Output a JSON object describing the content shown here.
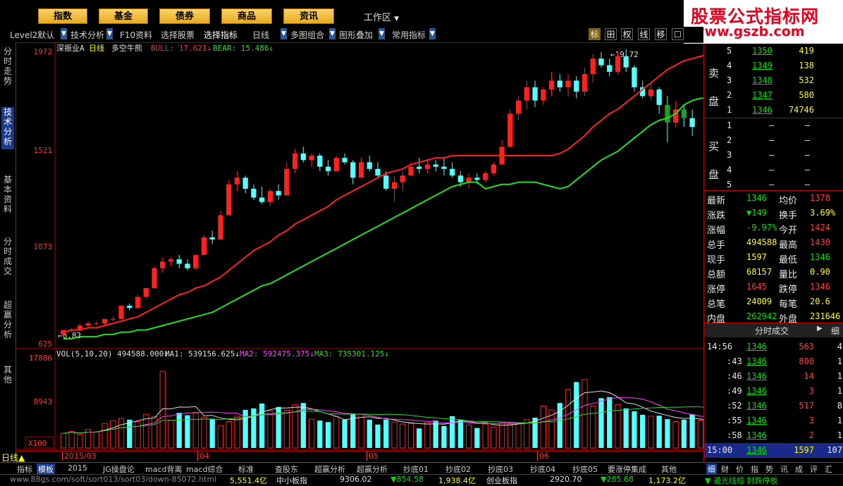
{
  "topnav": {
    "buttons": [
      "指数",
      "基金",
      "债券",
      "商品",
      "资讯"
    ],
    "workarea": "工作区"
  },
  "watermark": {
    "line1": "股票公式指标网",
    "line2": "www.gszb.com"
  },
  "toolbar": {
    "items": [
      "Level2默认",
      "技术分析",
      "F10资料",
      "选择股票",
      "选择指标",
      "日线",
      "多图组合",
      "图形叠加",
      "常用指标"
    ],
    "icons": [
      "标",
      "田",
      "权",
      "线",
      "移",
      "☐"
    ]
  },
  "lefttabs": [
    "分时走势",
    "技术分析",
    "基本资料",
    "分时成交",
    "超赢分析",
    "其他"
  ],
  "chart": {
    "stock_label": "深振业A",
    "period_label": "日线",
    "indicator_name": "多空牛熊",
    "bull_text": "BULL: 17.621↓",
    "bear_text": "BEAR: 15.486↓",
    "price_ticks": [
      "1972",
      "1521",
      "1073",
      "625"
    ],
    "high_note": "←19.72",
    "low_note": "←6.82",
    "vol_text": "VOL(5,10,20) 494588.000↓",
    "ma1_text": "MA1: 539156.625↓",
    "ma2_text": "MA2: 592475.375↓",
    "ma3_text": "MA3: 735301.125↓",
    "vol_ticks": [
      "17886",
      "8943"
    ],
    "vol_unit": "X100",
    "months": [
      "2015/03",
      "04",
      "05",
      "06"
    ],
    "colors": {
      "up": "#ff2020",
      "down": "#55ffff",
      "bull": "#ff2020",
      "bear": "#20e020"
    }
  },
  "chart_data": {
    "type": "candlestick",
    "candles": [
      [
        6.8,
        7.0,
        6.7,
        7.0
      ],
      [
        7.0,
        7.1,
        6.9,
        7.0
      ],
      [
        7.0,
        7.3,
        7.0,
        7.2
      ],
      [
        7.2,
        7.4,
        7.1,
        7.3
      ],
      [
        7.3,
        7.4,
        7.2,
        7.3
      ],
      [
        7.3,
        7.5,
        7.2,
        7.5
      ],
      [
        7.5,
        7.6,
        7.4,
        7.5
      ],
      [
        7.5,
        8.1,
        7.5,
        8.1
      ],
      [
        8.1,
        8.2,
        7.9,
        8.0
      ],
      [
        8.0,
        8.6,
        8.0,
        8.5
      ],
      [
        8.5,
        8.9,
        8.4,
        8.9
      ],
      [
        8.9,
        9.9,
        8.9,
        9.8
      ],
      [
        9.8,
        10.3,
        9.6,
        10.1
      ],
      [
        10.1,
        10.3,
        9.9,
        10.2
      ],
      [
        10.2,
        10.4,
        9.8,
        10.0
      ],
      [
        10.0,
        10.2,
        9.7,
        9.8
      ],
      [
        9.8,
        10.4,
        9.7,
        10.4
      ],
      [
        10.4,
        11.3,
        10.4,
        11.2
      ],
      [
        11.2,
        11.5,
        10.9,
        11.1
      ],
      [
        11.1,
        12.4,
        11.1,
        12.2
      ],
      [
        12.2,
        13.8,
        12.2,
        13.6
      ],
      [
        13.6,
        14.2,
        13.3,
        13.9
      ],
      [
        13.9,
        14.0,
        13.2,
        13.4
      ],
      [
        13.4,
        13.6,
        12.9,
        13.0
      ],
      [
        13.0,
        13.5,
        12.7,
        12.8
      ],
      [
        12.8,
        13.4,
        12.6,
        13.3
      ],
      [
        13.3,
        13.6,
        12.9,
        13.1
      ],
      [
        13.1,
        14.6,
        13.1,
        14.3
      ],
      [
        14.3,
        15.2,
        14.1,
        15.0
      ],
      [
        15.0,
        15.3,
        14.6,
        14.7
      ],
      [
        14.7,
        15.0,
        14.4,
        14.9
      ],
      [
        14.9,
        15.0,
        14.2,
        14.4
      ],
      [
        14.4,
        14.7,
        14.0,
        14.2
      ],
      [
        14.2,
        14.9,
        14.2,
        14.8
      ],
      [
        14.8,
        15.0,
        14.5,
        14.6
      ],
      [
        14.6,
        14.7,
        13.6,
        13.9
      ],
      [
        13.9,
        14.8,
        13.9,
        14.6
      ],
      [
        14.6,
        14.9,
        14.2,
        14.3
      ],
      [
        14.3,
        14.6,
        13.9,
        14.0
      ],
      [
        14.0,
        14.2,
        13.3,
        13.4
      ],
      [
        13.4,
        14.0,
        12.8,
        13.7
      ],
      [
        13.7,
        14.2,
        13.3,
        14.0
      ],
      [
        14.0,
        14.6,
        14.0,
        14.4
      ],
      [
        14.4,
        14.8,
        14.1,
        14.3
      ],
      [
        14.3,
        14.7,
        14.1,
        14.5
      ],
      [
        14.5,
        14.7,
        14.2,
        14.4
      ],
      [
        14.4,
        14.8,
        14.0,
        14.3
      ],
      [
        14.3,
        14.6,
        13.9,
        14.0
      ],
      [
        14.0,
        14.2,
        13.5,
        13.7
      ],
      [
        13.7,
        14.1,
        13.4,
        13.9
      ],
      [
        13.9,
        14.1,
        13.6,
        13.8
      ],
      [
        13.8,
        14.2,
        13.7,
        14.1
      ],
      [
        14.1,
        14.6,
        14.0,
        14.5
      ],
      [
        14.5,
        15.6,
        14.5,
        15.3
      ],
      [
        15.3,
        17.0,
        15.3,
        16.8
      ],
      [
        16.8,
        17.6,
        16.5,
        17.4
      ],
      [
        17.4,
        18.3,
        17.0,
        18.0
      ],
      [
        18.0,
        18.3,
        17.1,
        17.4
      ],
      [
        17.4,
        18.0,
        17.2,
        17.9
      ],
      [
        17.9,
        18.7,
        17.6,
        18.3
      ],
      [
        18.3,
        18.6,
        17.8,
        18.0
      ],
      [
        18.0,
        18.6,
        17.6,
        18.3
      ],
      [
        18.3,
        18.5,
        17.5,
        17.8
      ],
      [
        17.8,
        18.9,
        17.6,
        18.6
      ],
      [
        18.6,
        19.5,
        18.2,
        19.3
      ],
      [
        19.3,
        19.6,
        18.9,
        19.0
      ],
      [
        19.0,
        19.3,
        18.5,
        18.7
      ],
      [
        18.7,
        19.6,
        18.6,
        19.4
      ],
      [
        19.4,
        19.72,
        18.7,
        18.9
      ],
      [
        18.9,
        19.0,
        17.8,
        18.0
      ],
      [
        18.0,
        18.3,
        17.5,
        17.6
      ],
      [
        17.6,
        18.2,
        17.4,
        17.9
      ],
      [
        17.9,
        18.0,
        16.8,
        17.2
      ],
      [
        17.2,
        17.6,
        15.5,
        16.4
      ],
      [
        16.4,
        17.4,
        16.2,
        17.0
      ],
      [
        17.0,
        17.2,
        16.2,
        16.6
      ],
      [
        16.6,
        17.0,
        15.8,
        16.2
      ]
    ],
    "bull": [
      6.9,
      7.0,
      7.0,
      7.1,
      7.1,
      7.2,
      7.3,
      7.4,
      7.5,
      7.6,
      7.8,
      8.0,
      8.2,
      8.4,
      8.6,
      8.7,
      8.9,
      9.0,
      9.2,
      9.4,
      9.7,
      10.0,
      10.3,
      10.6,
      10.8,
      11.0,
      11.3,
      11.5,
      11.8,
      12.0,
      12.2,
      12.4,
      12.6,
      12.9,
      13.1,
      13.3,
      13.5,
      13.7,
      13.9,
      14.1,
      14.2,
      14.3,
      14.5,
      14.6,
      14.7,
      14.8,
      14.8,
      14.9,
      14.9,
      14.9,
      14.9,
      14.9,
      14.9,
      14.9,
      14.9,
      14.9,
      14.9,
      14.9,
      14.9,
      14.9,
      15.0,
      15.2,
      15.5,
      15.8,
      16.2,
      16.5,
      16.8,
      17.0,
      17.3,
      17.6,
      17.9,
      18.2,
      18.5,
      18.8,
      19.0,
      19.2,
      19.3,
      19.4,
      19.5,
      19.5,
      19.4,
      19.3
    ],
    "bear": [
      6.6,
      6.6,
      6.7,
      6.7,
      6.7,
      6.8,
      6.8,
      6.9,
      6.9,
      7.0,
      7.0,
      7.1,
      7.2,
      7.3,
      7.4,
      7.5,
      7.6,
      7.7,
      7.8,
      8.0,
      8.2,
      8.4,
      8.6,
      8.8,
      9.0,
      9.1,
      9.3,
      9.5,
      9.7,
      9.9,
      10.1,
      10.3,
      10.5,
      10.7,
      10.9,
      11.1,
      11.3,
      11.5,
      11.7,
      11.9,
      12.1,
      12.3,
      12.5,
      12.7,
      12.9,
      13.1,
      13.3,
      13.5,
      13.6,
      13.7,
      13.7,
      13.4,
      13.5,
      13.6,
      13.6,
      13.7,
      13.7,
      13.7,
      13.6,
      13.5,
      13.4,
      13.5,
      13.8,
      14.1,
      14.4,
      14.7,
      14.9,
      15.1,
      15.4,
      15.7,
      16.0,
      16.3,
      16.5,
      16.6,
      16.8,
      17.2,
      17.4,
      17.5,
      17.5,
      17.4,
      17.4,
      17.2,
      17.1,
      17.0
    ],
    "volume": [
      3000,
      3400,
      2800,
      3800,
      3300,
      5000,
      5600,
      6100,
      5800,
      5400,
      6900,
      6400,
      15700,
      5700,
      7200,
      6700,
      7100,
      6300,
      6000,
      4600,
      5400,
      6500,
      7800,
      8100,
      9100,
      7600,
      8400,
      7700,
      8900,
      9200,
      5900,
      5600,
      5300,
      6400,
      5800,
      7000,
      6900,
      5800,
      4800,
      5800,
      5300,
      4900,
      5000,
      4000,
      5200,
      5600,
      4500,
      6500,
      5800,
      4700,
      4100,
      4900,
      4300,
      5300,
      4900,
      5100,
      5800,
      6200,
      8600,
      7800,
      9200,
      12000,
      13500,
      14000,
      8600,
      10200,
      10400,
      8900,
      8100,
      7500,
      6800,
      6500,
      6600,
      5900,
      5400,
      5800,
      6900,
      5700,
      4600,
      5200,
      5400,
      4900,
      4500
    ],
    "ylim": [
      6.25,
      19.72
    ],
    "x_ticks": [
      "2015/03",
      "04",
      "05",
      "06"
    ]
  },
  "orderbook": {
    "sell_label": "卖盘",
    "buy_label": "买盘",
    "sell": [
      {
        "lvl": "5",
        "price": "1350",
        "vol": "419"
      },
      {
        "lvl": "4",
        "price": "1349",
        "vol": "138"
      },
      {
        "lvl": "3",
        "price": "1348",
        "vol": "532"
      },
      {
        "lvl": "2",
        "price": "1347",
        "vol": "580"
      },
      {
        "lvl": "1",
        "price": "1346",
        "vol": "74746"
      }
    ],
    "buy": [
      {
        "lvl": "1",
        "price": "—",
        "vol": "—"
      },
      {
        "lvl": "2",
        "price": "—",
        "vol": "—"
      },
      {
        "lvl": "3",
        "price": "—",
        "vol": "—"
      },
      {
        "lvl": "4",
        "price": "—",
        "vol": "—"
      },
      {
        "lvl": "5",
        "price": "—",
        "vol": "—"
      }
    ]
  },
  "quote": [
    {
      "l1": "最新",
      "v1": "1346",
      "l2": "均价",
      "v2": "1378"
    },
    {
      "l1": "涨跌",
      "v1": "▼149",
      "l2": "换手",
      "v2": "3.69%"
    },
    {
      "l1": "涨幅",
      "v1": "-9.97%",
      "l2": "今开",
      "v2": "1424"
    },
    {
      "l1": "总手",
      "v1": "494588",
      "l2": "最高",
      "v2": "1430"
    },
    {
      "l1": "现手",
      "v1": "1597",
      "l2": "最低",
      "v2": "1346"
    },
    {
      "l1": "总额",
      "v1": "68157",
      "l2": "量比",
      "v2": "0.90"
    },
    {
      "l1": "涨停",
      "v1": "1645",
      "l2": "跌停",
      "v2": "1346"
    },
    {
      "l1": "总笔",
      "v1": "24009",
      "l2": "每笔",
      "v2": "20.6"
    },
    {
      "l1": "内盘",
      "v1": "262942",
      "l2": "外盘",
      "v2": "231646"
    }
  ],
  "ticks_header": {
    "title": "分时成交",
    "btn": "细"
  },
  "trades": [
    {
      "t": "14:56",
      "p": "1346",
      "v": "563",
      "n": "4"
    },
    {
      "t": ":43",
      "p": "1346",
      "v": "800",
      "n": "1"
    },
    {
      "t": ":46",
      "p": "1346",
      "v": "14",
      "n": "1"
    },
    {
      "t": ":49",
      "p": "1346",
      "v": "3",
      "n": "1"
    },
    {
      "t": ":52",
      "p": "1346",
      "v": "517",
      "n": "8"
    },
    {
      "t": ":55",
      "p": "1346",
      "v": "3",
      "n": "1"
    },
    {
      "t": ":58",
      "p": "1346",
      "v": "2",
      "n": "1"
    },
    {
      "t": "15:00",
      "p": "1346",
      "v": "1597",
      "n": "107"
    }
  ],
  "bottom_tabs": [
    "指标",
    "模板",
    "2015",
    "JG操盘论",
    "macd背离",
    "macd综合",
    "标准",
    "查股东",
    "超赢分析",
    "超赢分析",
    "抄底01",
    "抄底02",
    "抄底03",
    "抄底04",
    "抄底05",
    "要涨停集成",
    "其他"
  ],
  "right_tabs": [
    "细",
    "财",
    "价",
    "指",
    "势",
    "讯",
    "成",
    "评",
    "汇"
  ],
  "status": {
    "url": "www.88gs.com/soft/sort013/sort03/down-85072.html",
    "amt1": "5,551.4亿",
    "name2": "中小板指",
    "val2": "9306.02",
    "chg2": "▼854.58",
    "amt2": "1,938.4亿",
    "name3": "创业板指",
    "val3": "2920.70",
    "chg3": "▼285.68",
    "amt3": "1,173.2亿",
    "ticker": "▼ 通光线缆 封跌停板"
  }
}
